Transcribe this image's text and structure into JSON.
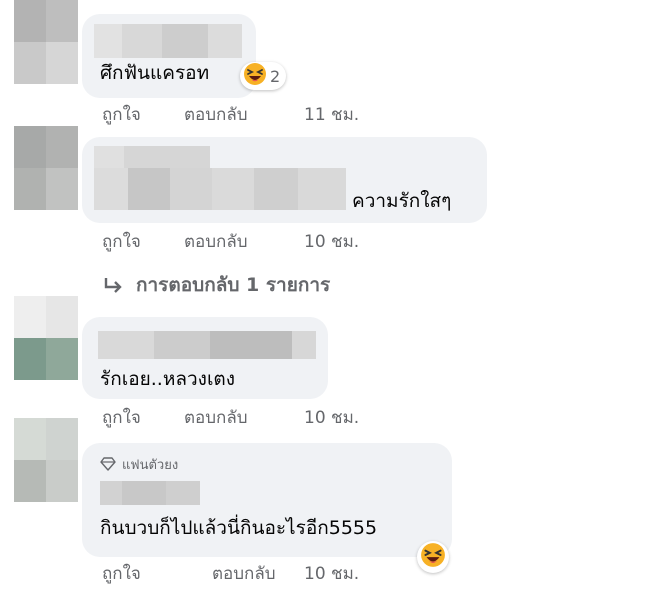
{
  "comments": [
    {
      "text": "ศึกฟันแครอท",
      "reaction": {
        "icon": "laughing-emoji-icon",
        "count": "2"
      },
      "actions": {
        "like": "ถูกใจ",
        "reply": "ตอบกลับ",
        "time": "11 ชม."
      }
    },
    {
      "text": "ความรักใสๆ",
      "actions": {
        "like": "ถูกใจ",
        "reply": "ตอบกลับ",
        "time": "10 ชม."
      },
      "replies_link": "การตอบกลับ 1 รายการ"
    },
    {
      "text": "รักเอย..หลวงเตง",
      "actions": {
        "like": "ถูกใจ",
        "reply": "ตอบกลับ",
        "time": "10 ชม."
      }
    },
    {
      "badge": "แฟนตัวยง",
      "badge_icon": "diamond-icon",
      "text": "กินบวบก็ไปแล้วนี่กินอะไรอีก5555",
      "reaction": {
        "icon": "laughing-emoji-icon"
      },
      "actions": {
        "like": "ถูกใจ",
        "reply": "ตอบกลับ",
        "time": "10 ชม."
      }
    }
  ],
  "colors": {
    "bubble": "#f0f2f5",
    "meta_text": "#65676b",
    "text": "#050505"
  }
}
